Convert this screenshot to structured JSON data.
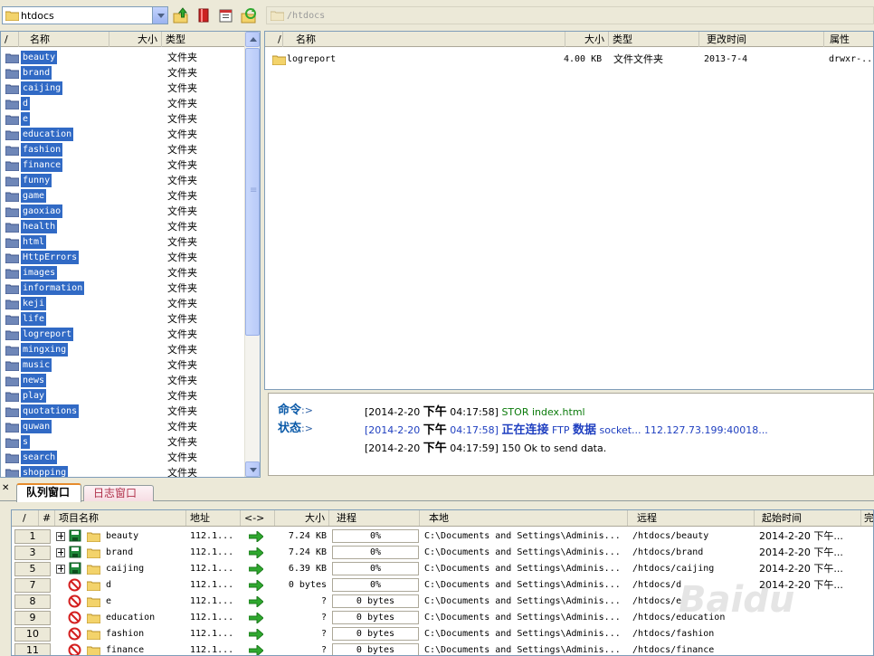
{
  "left_toolbar": {
    "site_combo_value": "htdocs"
  },
  "right_toolbar": {
    "path_value": "/htdocs"
  },
  "left_list": {
    "columns": [
      "/",
      "名称",
      "大小",
      "类型"
    ],
    "items": [
      {
        "name": "beauty",
        "type": "文件夹"
      },
      {
        "name": "brand",
        "type": "文件夹"
      },
      {
        "name": "caijing",
        "type": "文件夹"
      },
      {
        "name": "d",
        "type": "文件夹"
      },
      {
        "name": "e",
        "type": "文件夹"
      },
      {
        "name": "education",
        "type": "文件夹"
      },
      {
        "name": "fashion",
        "type": "文件夹"
      },
      {
        "name": "finance",
        "type": "文件夹"
      },
      {
        "name": "funny",
        "type": "文件夹"
      },
      {
        "name": "game",
        "type": "文件夹"
      },
      {
        "name": "gaoxiao",
        "type": "文件夹"
      },
      {
        "name": "health",
        "type": "文件夹"
      },
      {
        "name": "html",
        "type": "文件夹"
      },
      {
        "name": "HttpErrors",
        "type": "文件夹"
      },
      {
        "name": "images",
        "type": "文件夹"
      },
      {
        "name": "information",
        "type": "文件夹"
      },
      {
        "name": "keji",
        "type": "文件夹"
      },
      {
        "name": "life",
        "type": "文件夹"
      },
      {
        "name": "logreport",
        "type": "文件夹"
      },
      {
        "name": "mingxing",
        "type": "文件夹"
      },
      {
        "name": "music",
        "type": "文件夹"
      },
      {
        "name": "news",
        "type": "文件夹"
      },
      {
        "name": "play",
        "type": "文件夹"
      },
      {
        "name": "quotations",
        "type": "文件夹"
      },
      {
        "name": "quwan",
        "type": "文件夹"
      },
      {
        "name": "s",
        "type": "文件夹"
      },
      {
        "name": "search",
        "type": "文件夹"
      },
      {
        "name": "shopping",
        "type": "文件夹"
      }
    ]
  },
  "right_list": {
    "columns": [
      "/",
      "名称",
      "大小",
      "类型",
      "更改时间",
      "属性"
    ],
    "items": [
      {
        "name": "logreport",
        "size": "4.00 KB",
        "type": "文件文件夹",
        "modified": "2013-7-4",
        "attr": "drwxr-..."
      }
    ]
  },
  "log": {
    "cmd_label": "命令",
    "status_label": "状态",
    "prompt": ":>",
    "lines": [
      {
        "date": "[2014-2-20",
        "ampm": "下午",
        "time": "04:17:58]",
        "text": "STOR index.html"
      },
      {
        "date": "[2014-2-20",
        "ampm": "下午",
        "time": "04:17:58]",
        "text_a": "正在连接",
        "text_b": "FTP",
        "text_c": "数据",
        "text_d": "socket... 112.127.73.199:40018..."
      },
      {
        "date": "[2014-2-20",
        "ampm": "下午",
        "time": "04:17:59]",
        "text": "150 Ok to send data."
      }
    ]
  },
  "tabs": {
    "queue": "队列窗口",
    "log": "日志窗口"
  },
  "queue": {
    "columns": [
      "/",
      "#",
      "项目名称",
      "地址",
      "<->",
      "大小",
      "进程",
      "本地",
      "远程",
      "起始时间",
      "完"
    ],
    "rows": [
      {
        "num": "1",
        "kind": "folder",
        "name": "beauty",
        "addr": "112.1...",
        "size": "7.24 KB",
        "progress": "0%",
        "local": "C:\\Documents and Settings\\Adminis...",
        "remote": "/htdocs/beauty",
        "start": "2014-2-20 下午..."
      },
      {
        "num": "3",
        "kind": "folder",
        "name": "brand",
        "addr": "112.1...",
        "size": "7.24 KB",
        "progress": "0%",
        "local": "C:\\Documents and Settings\\Adminis...",
        "remote": "/htdocs/brand",
        "start": "2014-2-20 下午..."
      },
      {
        "num": "5",
        "kind": "folder",
        "name": "caijing",
        "addr": "112.1...",
        "size": "6.39 KB",
        "progress": "0%",
        "local": "C:\\Documents and Settings\\Adminis...",
        "remote": "/htdocs/caijing",
        "start": "2014-2-20 下午..."
      },
      {
        "num": "7",
        "kind": "blocked",
        "name": "d",
        "addr": "112.1...",
        "size": "0 bytes",
        "progress": "0%",
        "local": "C:\\Documents and Settings\\Adminis...",
        "remote": "/htdocs/d",
        "start": "2014-2-20 下午..."
      },
      {
        "num": "8",
        "kind": "blocked",
        "name": "e",
        "addr": "112.1...",
        "size": "?",
        "progress": "0 bytes",
        "local": "C:\\Documents and Settings\\Adminis...",
        "remote": "/htdocs/e",
        "start": ""
      },
      {
        "num": "9",
        "kind": "blocked",
        "name": "education",
        "addr": "112.1...",
        "size": "?",
        "progress": "0 bytes",
        "local": "C:\\Documents and Settings\\Adminis...",
        "remote": "/htdocs/education",
        "start": ""
      },
      {
        "num": "10",
        "kind": "blocked",
        "name": "fashion",
        "addr": "112.1...",
        "size": "?",
        "progress": "0 bytes",
        "local": "C:\\Documents and Settings\\Adminis...",
        "remote": "/htdocs/fashion",
        "start": ""
      },
      {
        "num": "11",
        "kind": "blocked",
        "name": "finance",
        "addr": "112.1...",
        "size": "?",
        "progress": "0 bytes",
        "local": "C:\\Documents and Settings\\Adminis...",
        "remote": "/htdocs/finance",
        "start": ""
      }
    ]
  },
  "colors": {
    "selection": "#316ac5",
    "log_label": "#0b5aa8",
    "log_time": "#0a7a0a",
    "arrow": "#2fa82f"
  }
}
